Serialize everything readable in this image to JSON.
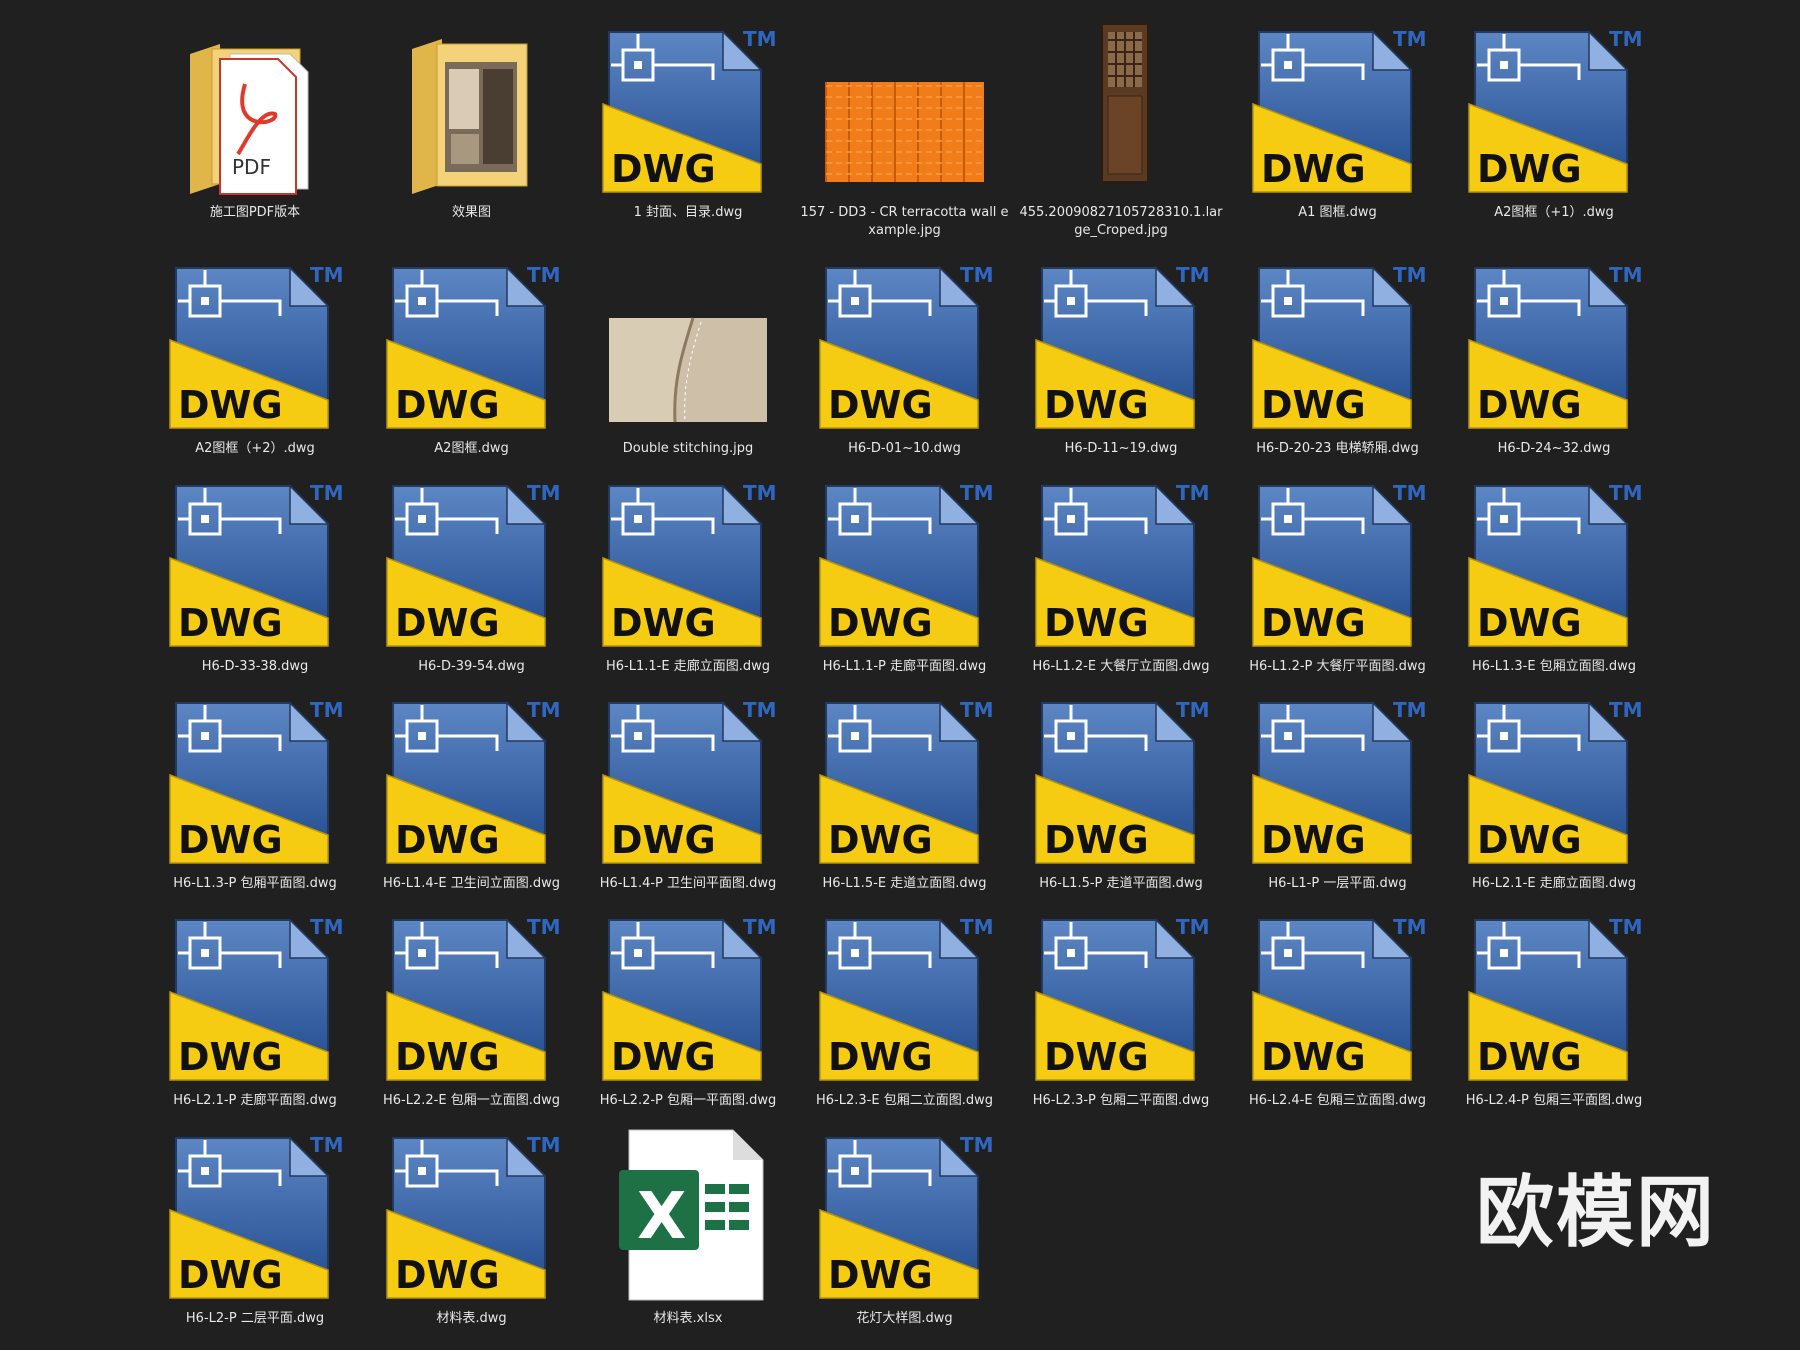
{
  "files": [
    {
      "type": "pdf-folder",
      "name": "施工图PDF版本",
      "icon": "pdf-folder-icon"
    },
    {
      "type": "image-folder",
      "name": "效果图",
      "icon": "image-folder-icon"
    },
    {
      "type": "dwg",
      "name": "1 封面、目录.dwg",
      "icon": "dwg-file-icon"
    },
    {
      "type": "image-terracotta",
      "name": "157 - DD3 - CR terracotta wall example.jpg",
      "icon": "terracotta-image-thumbnail"
    },
    {
      "type": "image-door",
      "name": "455.20090827105728310.1.large_Croped.jpg",
      "icon": "wooden-door-image-thumbnail"
    },
    {
      "type": "dwg",
      "name": "A1 图框.dwg",
      "icon": "dwg-file-icon"
    },
    {
      "type": "dwg",
      "name": "A2图框（+1）.dwg",
      "icon": "dwg-file-icon"
    },
    {
      "type": "dwg",
      "name": "A2图框（+2）.dwg",
      "icon": "dwg-file-icon"
    },
    {
      "type": "dwg",
      "name": "A2图框.dwg",
      "icon": "dwg-file-icon"
    },
    {
      "type": "image-leather",
      "name": "Double stitching.jpg",
      "icon": "leather-image-thumbnail"
    },
    {
      "type": "dwg",
      "name": "H6-D-01~10.dwg",
      "icon": "dwg-file-icon"
    },
    {
      "type": "dwg",
      "name": "H6-D-11~19.dwg",
      "icon": "dwg-file-icon"
    },
    {
      "type": "dwg",
      "name": "H6-D-20-23 电梯轿厢.dwg",
      "icon": "dwg-file-icon"
    },
    {
      "type": "dwg",
      "name": "H6-D-24~32.dwg",
      "icon": "dwg-file-icon"
    },
    {
      "type": "dwg",
      "name": "H6-D-33-38.dwg",
      "icon": "dwg-file-icon"
    },
    {
      "type": "dwg",
      "name": "H6-D-39-54.dwg",
      "icon": "dwg-file-icon"
    },
    {
      "type": "dwg",
      "name": "H6-L1.1-E 走廊立面图.dwg",
      "icon": "dwg-file-icon"
    },
    {
      "type": "dwg",
      "name": "H6-L1.1-P 走廊平面图.dwg",
      "icon": "dwg-file-icon"
    },
    {
      "type": "dwg",
      "name": "H6-L1.2-E 大餐厅立面图.dwg",
      "icon": "dwg-file-icon"
    },
    {
      "type": "dwg",
      "name": "H6-L1.2-P 大餐厅平面图.dwg",
      "icon": "dwg-file-icon"
    },
    {
      "type": "dwg",
      "name": "H6-L1.3-E 包厢立面图.dwg",
      "icon": "dwg-file-icon"
    },
    {
      "type": "dwg",
      "name": "H6-L1.3-P 包厢平面图.dwg",
      "icon": "dwg-file-icon"
    },
    {
      "type": "dwg",
      "name": "H6-L1.4-E 卫生间立面图.dwg",
      "icon": "dwg-file-icon"
    },
    {
      "type": "dwg",
      "name": "H6-L1.4-P 卫生间平面图.dwg",
      "icon": "dwg-file-icon"
    },
    {
      "type": "dwg",
      "name": "H6-L1.5-E 走道立面图.dwg",
      "icon": "dwg-file-icon"
    },
    {
      "type": "dwg",
      "name": "H6-L1.5-P 走道平面图.dwg",
      "icon": "dwg-file-icon"
    },
    {
      "type": "dwg",
      "name": "H6-L1-P 一层平面.dwg",
      "icon": "dwg-file-icon"
    },
    {
      "type": "dwg",
      "name": "H6-L2.1-E 走廊立面图.dwg",
      "icon": "dwg-file-icon"
    },
    {
      "type": "dwg",
      "name": "H6-L2.1-P 走廊平面图.dwg",
      "icon": "dwg-file-icon"
    },
    {
      "type": "dwg",
      "name": "H6-L2.2-E 包厢一立面图.dwg",
      "icon": "dwg-file-icon"
    },
    {
      "type": "dwg",
      "name": "H6-L2.2-P 包厢一平面图.dwg",
      "icon": "dwg-file-icon"
    },
    {
      "type": "dwg",
      "name": "H6-L2.3-E 包厢二立面图.dwg",
      "icon": "dwg-file-icon"
    },
    {
      "type": "dwg",
      "name": "H6-L2.3-P 包厢二平面图.dwg",
      "icon": "dwg-file-icon"
    },
    {
      "type": "dwg",
      "name": "H6-L2.4-E 包厢三立面图.dwg",
      "icon": "dwg-file-icon"
    },
    {
      "type": "dwg",
      "name": "H6-L2.4-P 包厢三平面图.dwg",
      "icon": "dwg-file-icon"
    },
    {
      "type": "dwg",
      "name": "H6-L2-P  二层平面.dwg",
      "icon": "dwg-file-icon"
    },
    {
      "type": "dwg",
      "name": "材料表.dwg",
      "icon": "dwg-file-icon"
    },
    {
      "type": "xlsx",
      "name": "材料表.xlsx",
      "icon": "excel-file-icon"
    },
    {
      "type": "dwg",
      "name": "花灯大样图.dwg",
      "icon": "dwg-file-icon"
    }
  ],
  "dwg_icon": {
    "badge": "DWG",
    "trademark": "TM"
  },
  "excel_icon": {
    "letter": "X"
  },
  "pdf_icon": {
    "letter": "PDF"
  },
  "brand_watermark": "欧模网",
  "colors": {
    "background": "#202020",
    "dwg_blue": "#1f4a8c",
    "dwg_yellow": "#f5cc12",
    "excel_green": "#1e7145",
    "terracotta": "#f07d1a"
  }
}
